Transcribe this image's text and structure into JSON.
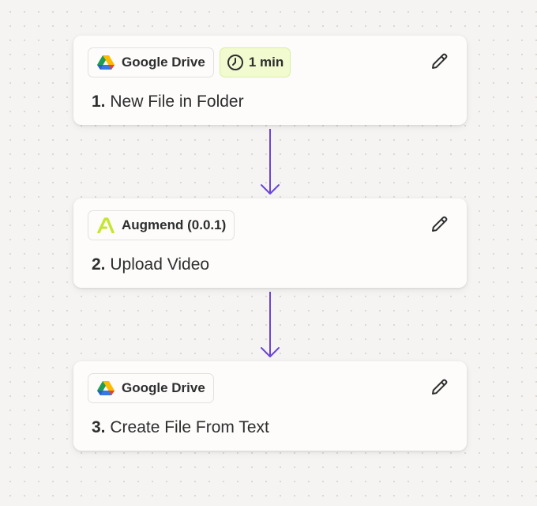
{
  "colors": {
    "accent": "#6a45d6",
    "time_chip_bg": "#f1fbcf",
    "text": "#2d2e2e"
  },
  "steps": [
    {
      "number": "1.",
      "title": "New File in Folder",
      "app": {
        "name": "Google Drive",
        "icon": "google-drive-icon"
      },
      "time": {
        "label": "1 min",
        "icon": "clock-icon"
      },
      "edit_icon": "pencil-icon"
    },
    {
      "number": "2.",
      "title": "Upload Video",
      "app": {
        "name": "Augmend (0.0.1)",
        "icon": "augmend-icon"
      },
      "edit_icon": "pencil-icon"
    },
    {
      "number": "3.",
      "title": "Create File From Text",
      "app": {
        "name": "Google Drive",
        "icon": "google-drive-icon"
      },
      "edit_icon": "pencil-icon"
    }
  ]
}
